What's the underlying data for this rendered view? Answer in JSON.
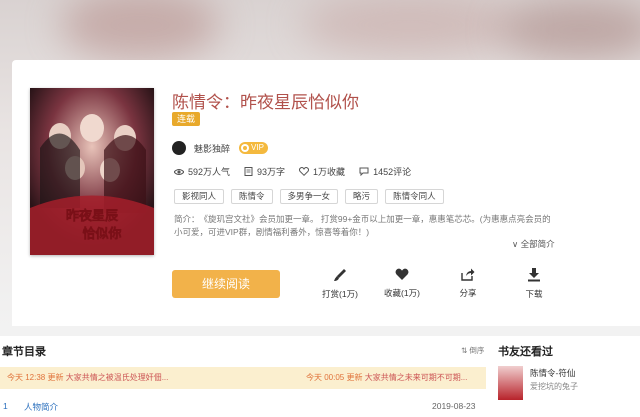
{
  "book": {
    "title": "陈情令：昨夜星辰恰似你",
    "status": "连载",
    "author": "魅影独醉",
    "vip_label": "VIP",
    "cover_text": "昨夜星辰恰似你",
    "stats": {
      "popularity": "592万人气",
      "words": "93万字",
      "favorites": "1万收藏",
      "comments": "1452评论"
    },
    "tags": [
      "影视同人",
      "陈情令",
      "多男争一女",
      "略污",
      "陈情令同人"
    ],
    "intro": "简介：　《旋玑宫文社》会员加更一章。 打赏99+金币以上加更一章，惠惠笔芯芯。(为惠惠点亮会员的小可爱，可进VIP群，剧情福利番外，惊喜等着你！)",
    "expand_label": "全部简介"
  },
  "actions": {
    "read_label": "继续阅读",
    "reward_label": "打赏(1万)",
    "favorite_label": "收藏(1万)",
    "share_label": "分享",
    "download_label": "下载"
  },
  "chapters": {
    "title": "章节目录",
    "sort_label": "倒序",
    "update_left_time": "今天 12:38 更新",
    "update_left_text": "大家共情之被温氏处理奸佃...",
    "update_right_time": "今天 00:05 更新",
    "update_right_text": "大家共情之未来可期不可期...",
    "first_chapter_index": "1",
    "first_chapter_title": "人物简介",
    "first_chapter_date": "2019-08-23"
  },
  "sidebar": {
    "title": "书友还看过",
    "book_title": "陈情令-符仙",
    "book_author": "爱挖坑的兔子"
  },
  "colors": {
    "title": "#b1514b",
    "accent": "#f2b24a",
    "status_badge": "#e8a92b",
    "update_bar": "#fbefcf"
  }
}
